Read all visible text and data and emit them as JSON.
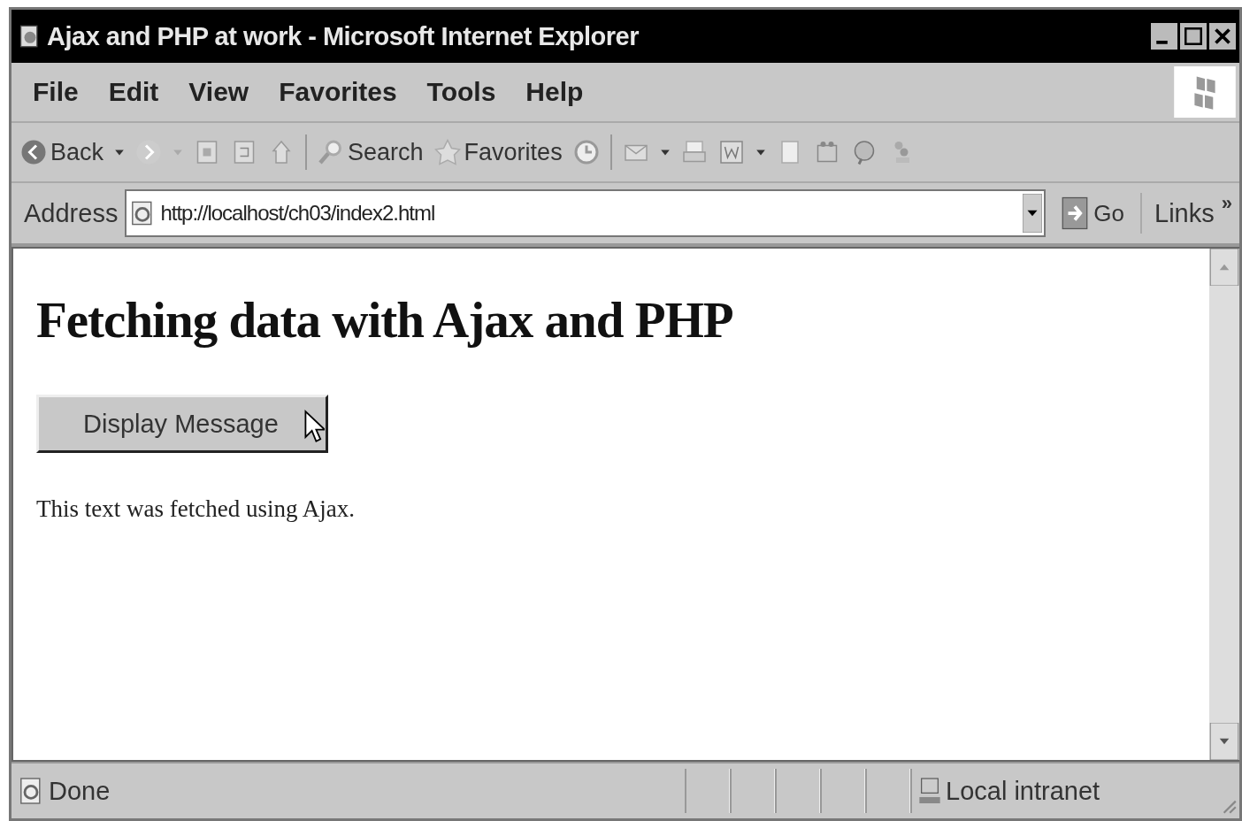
{
  "window": {
    "title": "Ajax and PHP at work - Microsoft Internet Explorer"
  },
  "menu": [
    "File",
    "Edit",
    "View",
    "Favorites",
    "Tools",
    "Help"
  ],
  "toolbar": {
    "back": "Back",
    "search": "Search",
    "favorites": "Favorites"
  },
  "address": {
    "label": "Address",
    "url": "http://localhost/ch03/index2.html",
    "go": "Go",
    "links": "Links",
    "more": "»"
  },
  "page": {
    "heading": "Fetching data with Ajax and PHP",
    "button": "Display Message",
    "text": "This text was fetched using Ajax."
  },
  "status_bar": {
    "text": "Done",
    "zone": "Local intranet"
  }
}
